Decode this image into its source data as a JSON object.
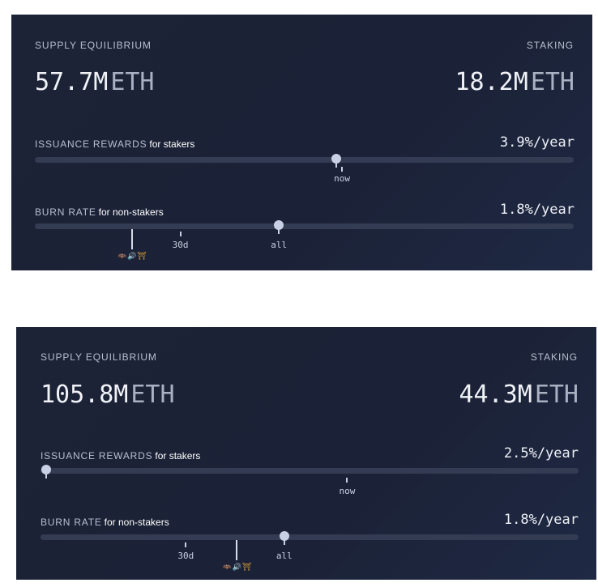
{
  "panels": [
    {
      "supply_label": "SUPPLY EQUILIBRIUM",
      "supply_value": "57.7M",
      "supply_unit": "ETH",
      "staking_label": "STAKING",
      "staking_value": "18.2M",
      "staking_unit": "ETH",
      "issuance": {
        "label": "ISSUANCE REWARDS",
        "sub": "for stakers",
        "rate": "3.9%/year",
        "thumb_fraction": 0.56,
        "marker": "now",
        "marker_fraction": 0.57
      },
      "burn": {
        "label": "BURN RATE",
        "sub": "for non-stakers",
        "rate": "1.8%/year",
        "thumb_fraction": 0.453,
        "markers": [
          "30d",
          "all"
        ],
        "marker_fractions": [
          0.27,
          0.453
        ],
        "icon_marker_fraction": 0.18,
        "icons": [
          "bat-icon",
          "speaker-icon",
          "torii-icon"
        ]
      }
    },
    {
      "supply_label": "SUPPLY EQUILIBRIUM",
      "supply_value": "105.8M",
      "supply_unit": "ETH",
      "staking_label": "STAKING",
      "staking_value": "44.3M",
      "staking_unit": "ETH",
      "issuance": {
        "label": "ISSUANCE REWARDS",
        "sub": "for stakers",
        "rate": "2.5%/year",
        "thumb_fraction": 0.01,
        "marker": "now",
        "marker_fraction": 0.57
      },
      "burn": {
        "label": "BURN RATE",
        "sub": "for non-stakers",
        "rate": "1.8%/year",
        "thumb_fraction": 0.453,
        "markers": [
          "30d",
          "all"
        ],
        "marker_fractions": [
          0.27,
          0.453
        ],
        "icon_marker_fraction": 0.365,
        "icons": [
          "bat-icon",
          "speaker-icon",
          "torii-icon"
        ]
      }
    }
  ]
}
